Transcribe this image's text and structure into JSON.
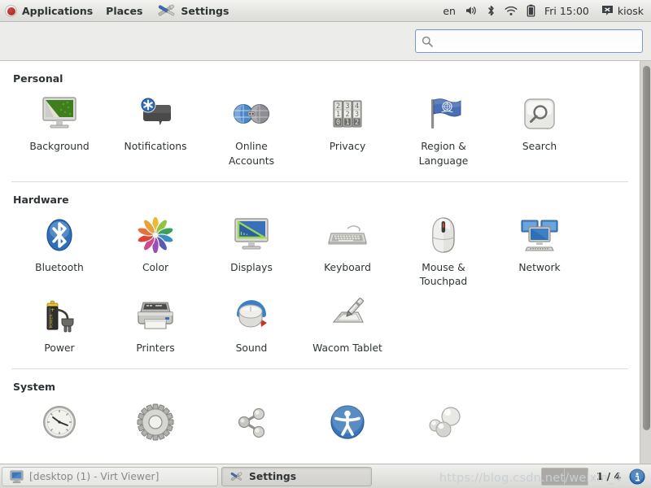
{
  "panel": {
    "logo_icon": "fedora-logo-icon",
    "menus": [
      {
        "label": "Applications",
        "name": "applications-menu"
      },
      {
        "label": "Places",
        "name": "places-menu"
      }
    ],
    "app_menu": {
      "label": "Settings",
      "icon": "settings-tools-icon"
    },
    "status": {
      "language": "en",
      "volume_icon": "volume-icon",
      "bluetooth_icon": "bluetooth-icon",
      "wifi_icon": "wifi-icon",
      "battery_icon": "battery-icon",
      "clock": "Fri 15:00",
      "user_icon": "user-status-icon",
      "user": "kiosk"
    }
  },
  "toolbar": {
    "search": {
      "value": "",
      "placeholder": "",
      "icon": "search-icon"
    }
  },
  "sections": [
    {
      "title": "Personal",
      "name": "section-personal",
      "items": [
        {
          "label": "Background",
          "icon": "background-icon"
        },
        {
          "label": "Notifications",
          "icon": "notifications-icon"
        },
        {
          "label": "Online\nAccounts",
          "icon": "online-accounts-icon"
        },
        {
          "label": "Privacy",
          "icon": "privacy-icon"
        },
        {
          "label": "Region &\nLanguage",
          "icon": "region-language-icon"
        },
        {
          "label": "Search",
          "icon": "search-panel-icon"
        }
      ]
    },
    {
      "title": "Hardware",
      "name": "section-hardware",
      "items": [
        {
          "label": "Bluetooth",
          "icon": "bluetooth-icon"
        },
        {
          "label": "Color",
          "icon": "color-icon"
        },
        {
          "label": "Displays",
          "icon": "displays-icon"
        },
        {
          "label": "Keyboard",
          "icon": "keyboard-icon"
        },
        {
          "label": "Mouse &\nTouchpad",
          "icon": "mouse-touchpad-icon"
        },
        {
          "label": "Network",
          "icon": "network-icon"
        },
        {
          "label": "Power",
          "icon": "power-icon"
        },
        {
          "label": "Printers",
          "icon": "printers-icon"
        },
        {
          "label": "Sound",
          "icon": "sound-icon"
        },
        {
          "label": "Wacom Tablet",
          "icon": "wacom-tablet-icon"
        }
      ]
    },
    {
      "title": "System",
      "name": "section-system",
      "items": [
        {
          "label": "",
          "icon": "date-time-icon"
        },
        {
          "label": "",
          "icon": "details-gear-icon"
        },
        {
          "label": "",
          "icon": "sharing-icon"
        },
        {
          "label": "",
          "icon": "universal-access-icon"
        },
        {
          "label": "",
          "icon": "users-icon"
        }
      ]
    }
  ],
  "taskbar": {
    "windows": [
      {
        "label": "[desktop (1) - Virt Viewer]",
        "icon": "display-window-icon",
        "state": "minimized"
      },
      {
        "label": "Settings",
        "icon": "settings-tools-icon",
        "state": "active"
      }
    ],
    "workspace_count": "1 / 4",
    "tray_icon": "info-tray-icon"
  },
  "watermark": "https://blog.csdn.net/weixin_4",
  "colors": {
    "panel_bg": "#e4e4e1",
    "toolbar_bg": "#ececeb",
    "content_bg": "#ffffff",
    "text": "#2e3436",
    "search_border": "#7a9bc4",
    "scrollbar": "#8f8e8b"
  }
}
